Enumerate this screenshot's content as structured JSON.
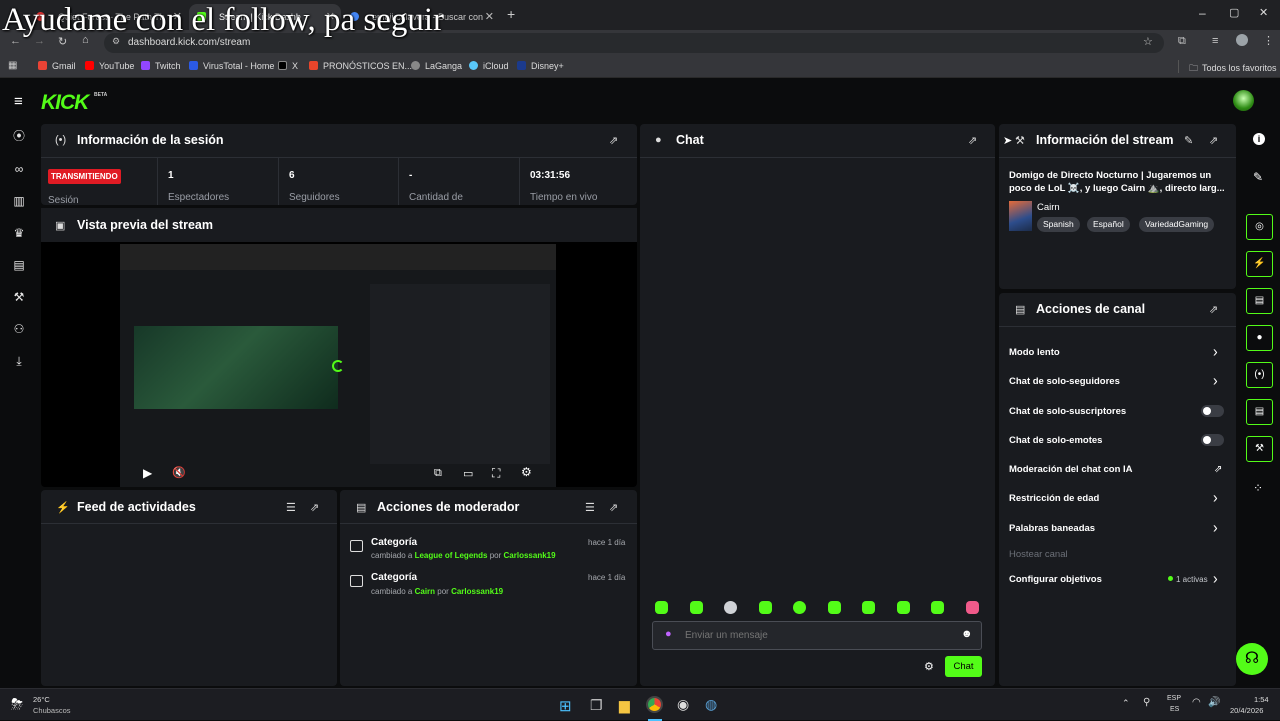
{
  "overlay_text": "Ayudame con el follow, pa seguir",
  "browser": {
    "tabs": [
      {
        "title": "Quiet Forest - The Path Th"
      },
      {
        "title": "Stream | Kick Dashb"
      },
      {
        "title": "emoji calavera - Buscar con"
      }
    ],
    "url": "dashboard.kick.com/stream",
    "bookmarks": [
      "Gmail",
      "YouTube",
      "Twitch",
      "VirusTotal - Home",
      "X",
      "PRONÓSTICOS EN...",
      "LaGanga",
      "iCloud",
      "Disney+"
    ],
    "bookmark_folder": "Todos los favoritos"
  },
  "kick": {
    "logo": "KICK",
    "beta": "BETA"
  },
  "session": {
    "title": "Información de la sesión",
    "status_badge": "TRANSMITIENDO",
    "status_label": "Sesión",
    "stats": [
      {
        "value": "1",
        "label": "Espectadores"
      },
      {
        "value": "6",
        "label": "Seguidores"
      },
      {
        "value": "-",
        "label": "Cantidad de"
      },
      {
        "value": "03:31:56",
        "label": "Tiempo en vivo"
      }
    ]
  },
  "preview": {
    "title": "Vista previa del stream"
  },
  "feed": {
    "title": "Feed de actividades"
  },
  "mod_actions": {
    "title": "Acciones de moderador",
    "items": [
      {
        "title": "Categoría",
        "prefix": "cambiado a",
        "target": "League of Legends",
        "by": "por",
        "user": "Carlossank19",
        "time": "hace 1 día"
      },
      {
        "title": "Categoría",
        "prefix": "cambiado a",
        "target": "Cairn",
        "by": "por",
        "user": "Carlossank19",
        "time": "hace 1 día"
      }
    ]
  },
  "chat": {
    "title": "Chat",
    "placeholder": "Enviar un mensaje",
    "send_label": "Chat"
  },
  "stream_info": {
    "title": "Información del stream",
    "stream_title": "Domigo de Directo Nocturno | Jugaremos un poco de LoL ☠️, y luego Cairn ⛰️, directo larg...",
    "category": "Cairn",
    "tags": [
      "Spanish",
      "Español",
      "VariedadGaming"
    ]
  },
  "channel_actions": {
    "title": "Acciones de canal",
    "items": [
      {
        "label": "Modo lento",
        "control": "chevron"
      },
      {
        "label": "Chat de solo-seguidores",
        "control": "chevron"
      },
      {
        "label": "Chat de solo-suscriptores",
        "control": "toggle"
      },
      {
        "label": "Chat de solo-emotes",
        "control": "toggle"
      },
      {
        "label": "Moderación del chat con IA",
        "control": "external"
      },
      {
        "label": "Restricción de edad",
        "control": "chevron"
      },
      {
        "label": "Palabras baneadas",
        "control": "chevron"
      },
      {
        "label": "Hostear canal",
        "control": "none"
      },
      {
        "label": "Configurar objetivos",
        "control": "chevron"
      }
    ],
    "goals_status": "1 activas"
  },
  "taskbar": {
    "weather_temp": "26°C",
    "weather_desc": "Chubascos",
    "lang_top": "ESP",
    "lang_bottom": "ES",
    "time": "1:54",
    "date": "20/4/2026"
  },
  "colors": {
    "accent": "#53fc18",
    "live": "#e01b24",
    "panel": "#191b1f",
    "background": "#0b0c0d"
  }
}
